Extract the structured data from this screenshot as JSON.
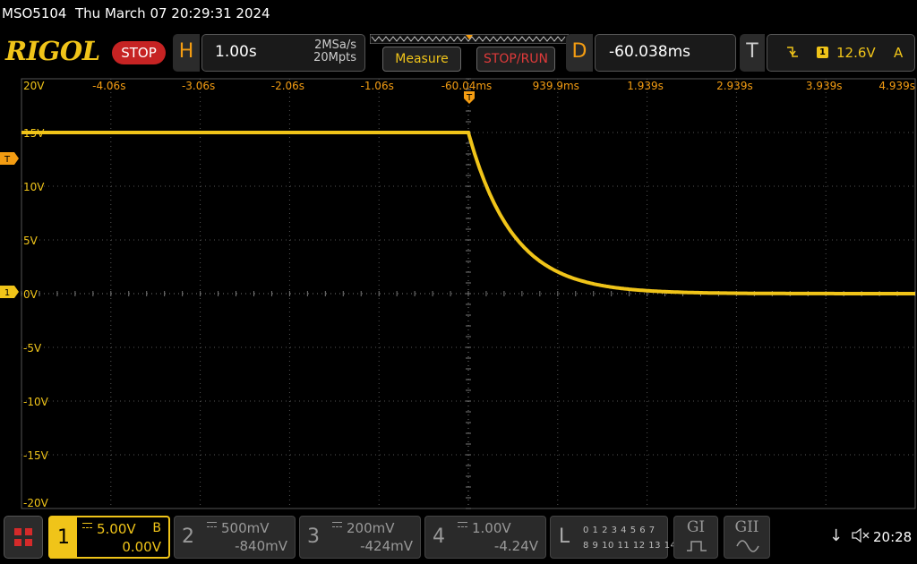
{
  "title_bar": {
    "model": "MSO5104",
    "datetime": "Thu March 07 20:29:31 2024"
  },
  "toolbar": {
    "logo": "RIGOL",
    "run_state": "STOP",
    "horizontal": {
      "letter": "H",
      "timebase": "1.00s",
      "sample_rate": "2MSa/s",
      "memory_depth": "20Mpts"
    },
    "measure_label": "Measure",
    "stop_run_label": "STOP/RUN",
    "delay": {
      "letter": "D",
      "value": "-60.038ms"
    },
    "trigger": {
      "letter": "T",
      "edge_icon": "falling-edge-icon",
      "source": "1",
      "level": "12.6V",
      "mode": "A"
    }
  },
  "grid": {
    "time_labels": [
      "-4.06s",
      "-3.06s",
      "-2.06s",
      "-1.06s",
      "-60.04ms",
      "939.9ms",
      "1.939s",
      "2.939s",
      "3.939s",
      "4.939s"
    ],
    "volt_labels": [
      "20V",
      "15V",
      "10V",
      "5V",
      "0V",
      "-5V",
      "-10V",
      "-15V",
      "-20V"
    ],
    "trigger_marker": "T",
    "channel_marker": "1"
  },
  "waveform": {
    "channel": "1",
    "color": "#f0c419",
    "initial_level_v": 15,
    "final_level_v": 0,
    "step_time_s": -0.06,
    "decay_tau_s": 0.5,
    "xlim_s": [
      -5.06,
      4.94
    ],
    "ylim_v": [
      -20,
      20
    ]
  },
  "channels": [
    {
      "num": "1",
      "scale": "5.00V",
      "offset": "0.00V",
      "bw": "B",
      "active": true
    },
    {
      "num": "2",
      "scale": "500mV",
      "offset": "-840mV",
      "active": false
    },
    {
      "num": "3",
      "scale": "200mV",
      "offset": "-424mV",
      "active": false
    },
    {
      "num": "4",
      "scale": "1.00V",
      "offset": "-4.24V",
      "active": false
    }
  ],
  "logic": {
    "letter": "L",
    "row1": "0 1 2 3  4 5 6 7",
    "row2": "8 9 10 11 12 13 14 15"
  },
  "generators": [
    {
      "label": "GI",
      "wave_icon": "square-wave-icon"
    },
    {
      "label": "GII",
      "wave_icon": "sine-wave-icon"
    }
  ],
  "status": {
    "time": "20:28",
    "usb_icon": "usb-icon",
    "speaker_icon": "speaker-muted-icon"
  }
}
